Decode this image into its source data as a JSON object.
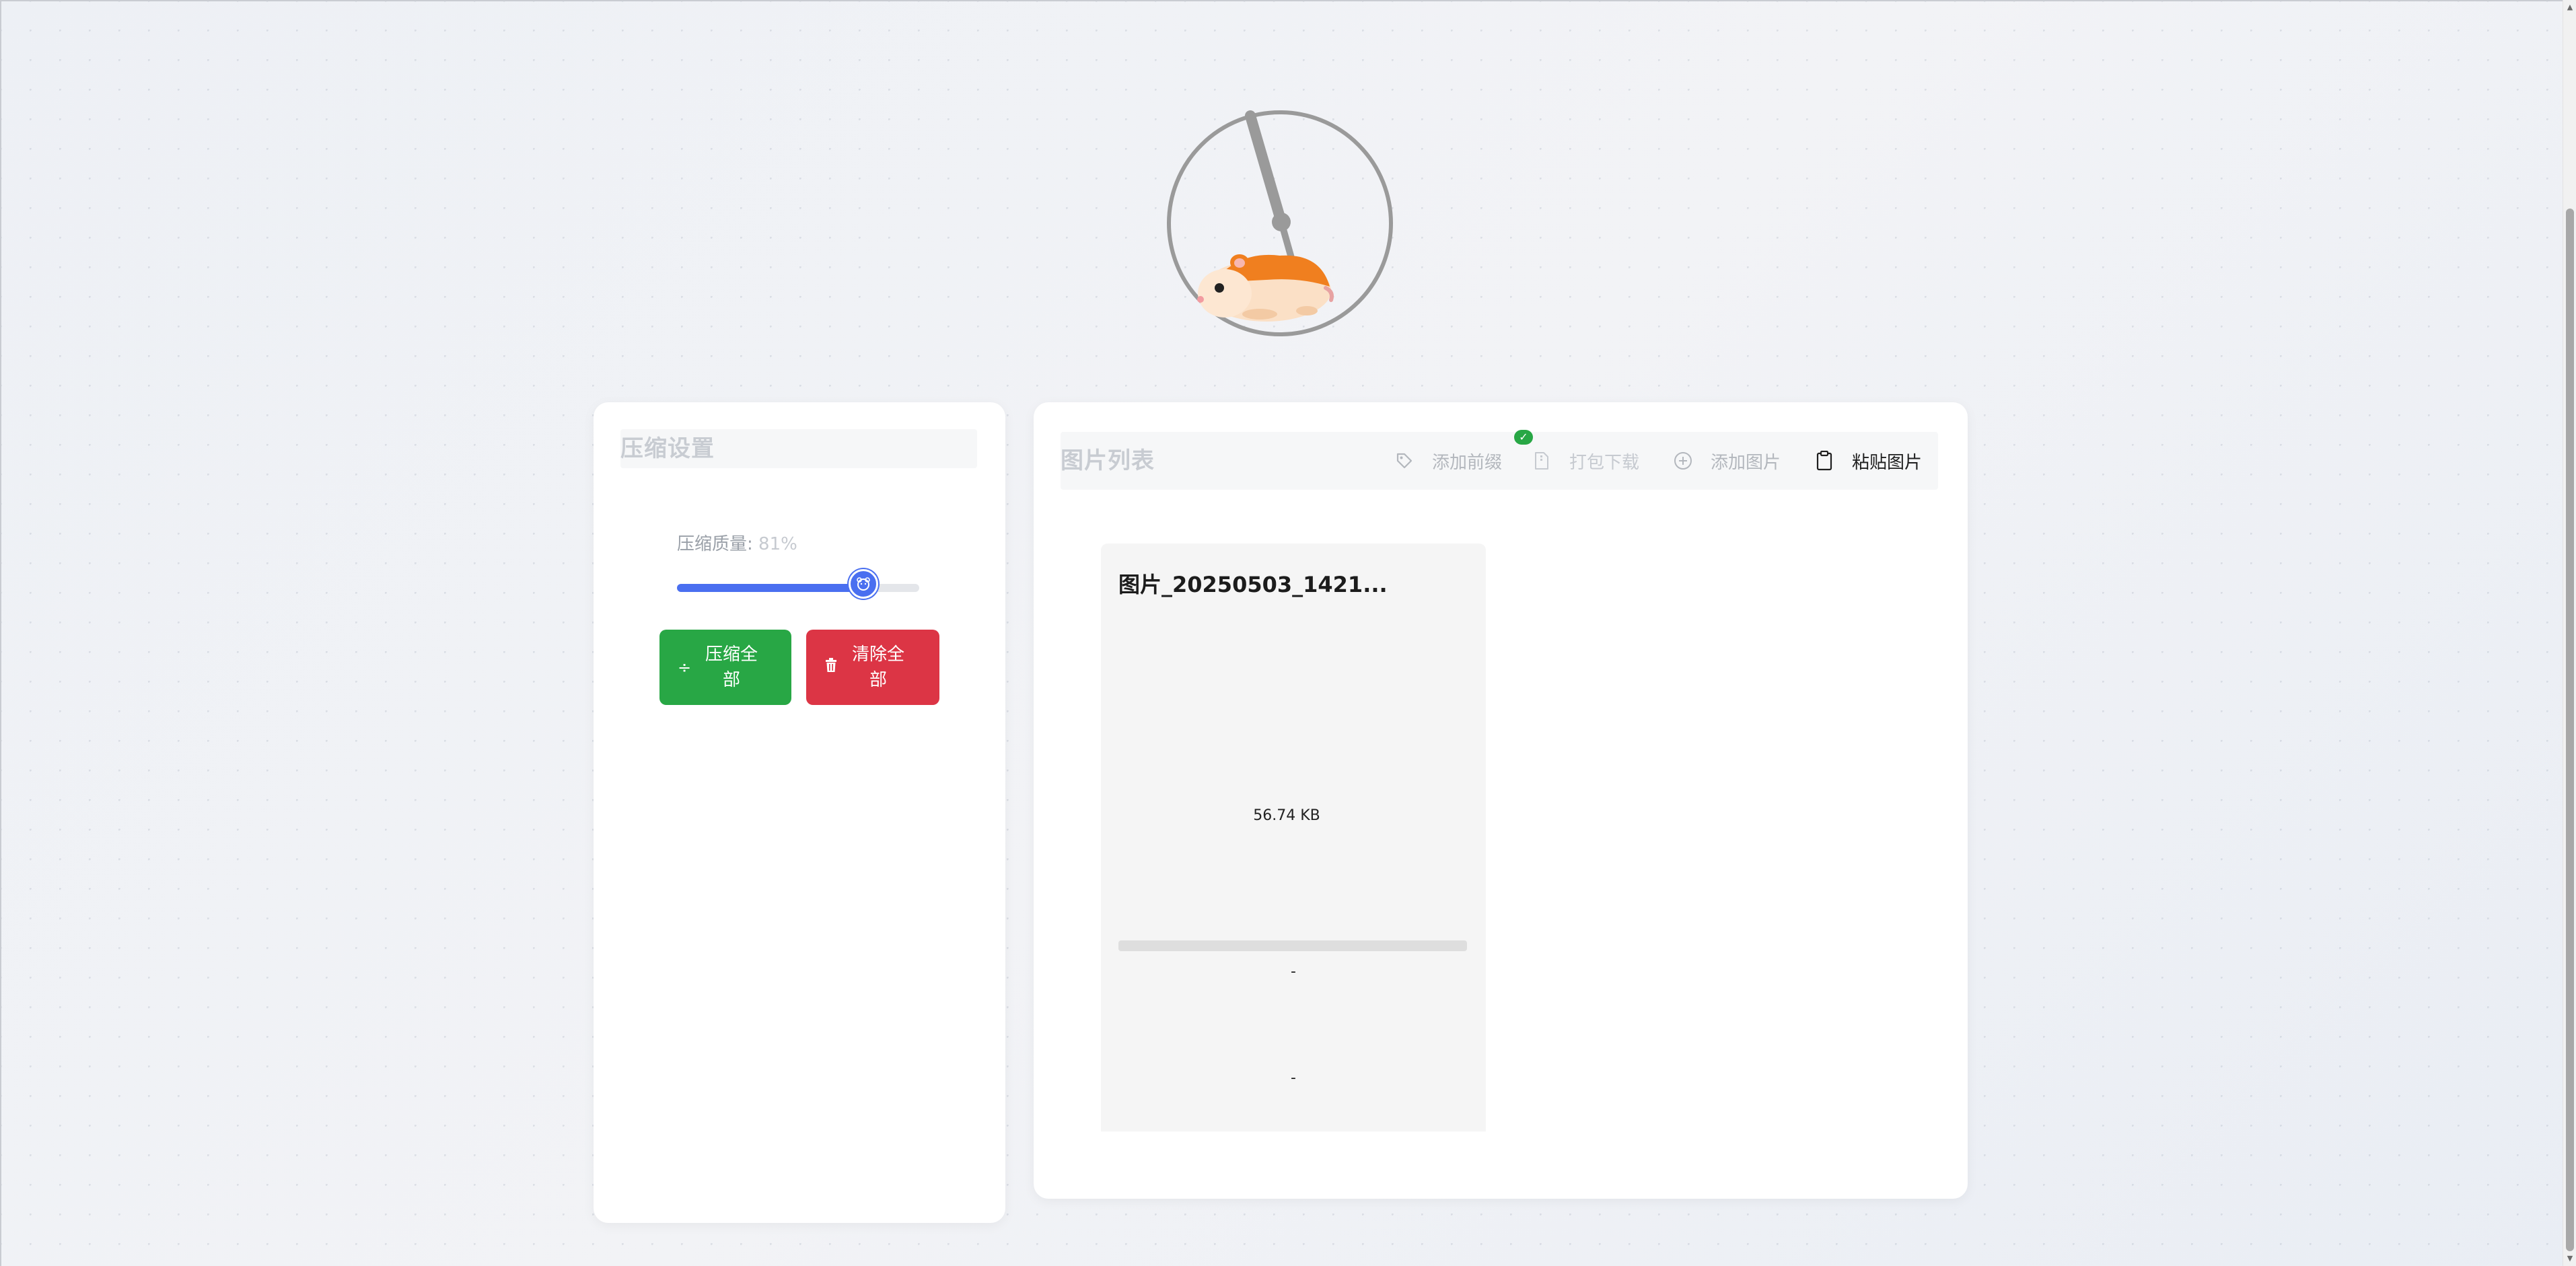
{
  "settings": {
    "title": "压缩设置",
    "quality_label": "压缩质量: ",
    "quality_value": "81%",
    "quality": 0.81,
    "compress_all": "压缩全部",
    "clear_all": "清除全部"
  },
  "images": {
    "title": "图片列表",
    "add_prefix": "添加前缀",
    "download_zip": "打包下载",
    "add_image": "添加图片",
    "paste_image": "粘贴图片",
    "items": [
      {
        "name": "图片_20250503_1421...",
        "size": "56.74 KB",
        "progress": 0,
        "compressed_size": "-",
        "ratio": "-"
      }
    ]
  },
  "colors": {
    "accent": "#4a6ff0",
    "success": "#28a745",
    "danger": "#dc3545",
    "hamster": "#f07f1f"
  }
}
